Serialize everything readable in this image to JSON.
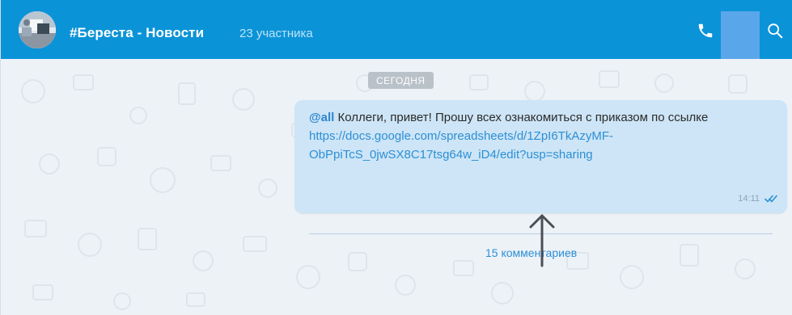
{
  "header": {
    "title": "#Береста - Новости",
    "members": "23 участника",
    "icons": [
      "avatar",
      "phone-icon",
      "search-icon"
    ],
    "colors": {
      "bar": "#0b93d8",
      "highlight": "#5aa6ea"
    }
  },
  "chat": {
    "date_separator": "СЕГОДНЯ",
    "message": {
      "mention": "@all",
      "text": " Коллеги, привет! Прошу всех ознакомиться с приказом по ссылке ",
      "link": "https://docs.google.com/spreadsheets/d/1ZpI6TkAzyMF-ObPpiTcS_0jwSX8C17tsg64w_iD4/edit?usp=sharing",
      "time": "14:11",
      "status_icon": "double-check-icon",
      "comments": "15 комментариев"
    },
    "colors": {
      "background": "#edf2f7",
      "bubble": "#cde5f6",
      "link": "#2d8fd5"
    }
  }
}
